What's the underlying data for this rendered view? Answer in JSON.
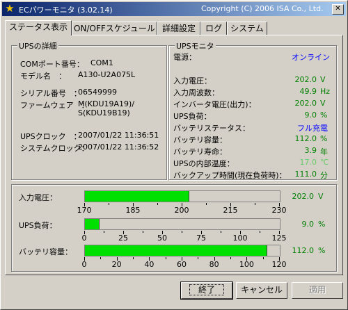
{
  "window": {
    "title": "ECパワーモニタ (3.02.14)",
    "copyright": "Copyright (C) 2006 ISA Co., Ltd.",
    "icon": "star-icon",
    "close": "✕"
  },
  "tabs": [
    "ステータス表示",
    "ON/OFFスケジュール",
    "詳細設定",
    "ログ",
    "システム"
  ],
  "details": {
    "title": "UPSの詳細",
    "com_label": "COMポート番号：",
    "com_value": "COM1",
    "model_label": "モデル名　：",
    "model_value": "A130-U2A075L",
    "serial_label": "シリアル番号　：",
    "serial_value": "06549999",
    "firmware_label": "ファームウェア　：",
    "firmware_value1": "M(KDU19A19)/",
    "firmware_value2": "S(KDU19B19)",
    "ups_clock_label": "UPSクロック　：",
    "ups_clock_value": "2007/01/22 11:36:51",
    "sys_clock_label": "システムクロック：",
    "sys_clock_value": "2007/01/22 11:36:52"
  },
  "monitor": {
    "title": "UPSモニタ",
    "power_label": "電源：",
    "power_value": "オンライン",
    "rows": [
      {
        "label": "入力電圧：",
        "value": "202.0",
        "unit": "V"
      },
      {
        "label": "入力周波数：",
        "value": "49.9",
        "unit": "Hz"
      },
      {
        "label": "インバータ電圧(出力)：",
        "value": "202.0",
        "unit": "V"
      },
      {
        "label": "UPS負荷：",
        "value": "9.0",
        "unit": "%"
      },
      {
        "label": "バッテリステータス：",
        "value": "フル充電",
        "unit": ""
      },
      {
        "label": "バッテリ容量：",
        "value": "112.0",
        "unit": "%"
      },
      {
        "label": "バッテリ寿命：",
        "value": "3.9",
        "unit": "年"
      },
      {
        "label": "UPSの内部温度：",
        "value": "17.0",
        "unit": "℃"
      },
      {
        "label": "バックアップ時間(現在負荷時)：",
        "value": "111.0",
        "unit": "分"
      }
    ]
  },
  "gauges": [
    {
      "label": "入力電圧：",
      "value_text": "202.0",
      "unit": "V",
      "min": 170,
      "max": 230,
      "value": 202.0,
      "ticks": [
        "170",
        "185",
        "200",
        "215",
        "230"
      ]
    },
    {
      "label": "UPS負荷：",
      "value_text": "9.0",
      "unit": "%",
      "min": 0,
      "max": 125,
      "value": 9.0,
      "ticks": [
        "0",
        "25",
        "50",
        "75",
        "100",
        "125"
      ]
    },
    {
      "label": "バッテリ容量：",
      "value_text": "112.0",
      "unit": "%",
      "min": 0,
      "max": 120,
      "value": 112.0,
      "ticks": [
        "0",
        "20",
        "40",
        "60",
        "80",
        "100",
        "120"
      ]
    }
  ],
  "buttons": {
    "exit": "終了",
    "cancel": "キャンセル",
    "apply": "適用"
  },
  "colors": {
    "fill": "#00e000",
    "value_green": "#008000",
    "online_blue": "#0000ff"
  }
}
